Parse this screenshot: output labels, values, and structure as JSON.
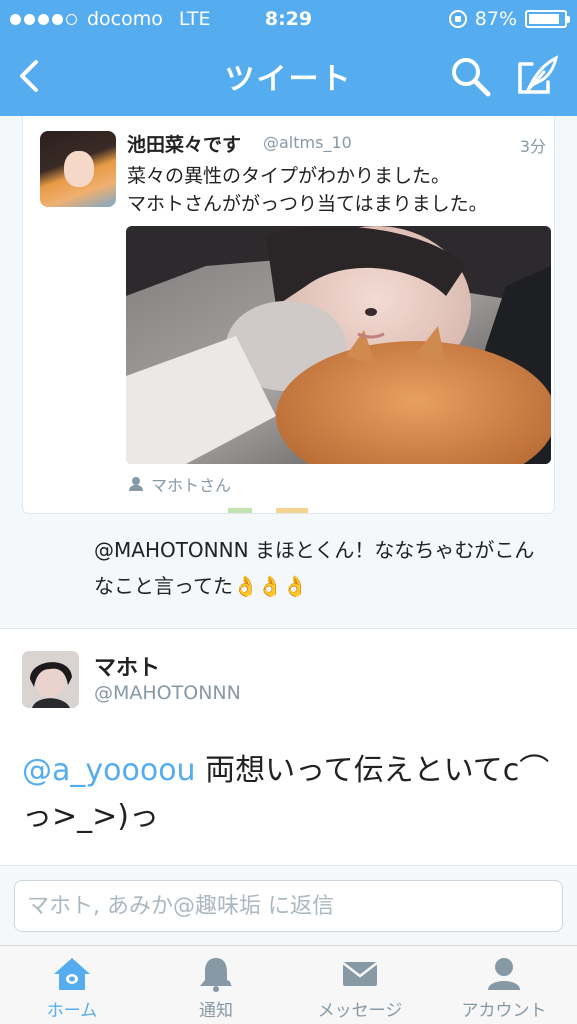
{
  "status_bar": {
    "carrier": "docomo",
    "network": "LTE",
    "time": "8:29",
    "battery_percent": "87%",
    "battery_level": 0.87,
    "signal_bars_filled": 4
  },
  "nav": {
    "title": "ツイート",
    "back_icon": "chevron-left-icon",
    "search_icon": "search-icon",
    "compose_icon": "compose-icon"
  },
  "quoted_tweet": {
    "name": "池田菜々です",
    "handle": "@altms_10",
    "time": "3分",
    "text_line1": "菜々の異性のタイプがわかりました。",
    "text_line2": "マホトさんががっつり当てはまりました。",
    "photo_caption": "マホトさん"
  },
  "reply_text": "@MAHOTONNN まほとくん！ななちゃむがこんなこと言ってた👌👌👌",
  "main_tweet": {
    "name": "マホト",
    "handle": "@MAHOTONNN",
    "mention": "@a_yoooou",
    "text": " 両想いって伝えといてc⌒っ>_>)っ"
  },
  "reply_bar": {
    "placeholder": "マホト, あみか@趣味垢 に返信"
  },
  "tabs": [
    {
      "label": "ホーム",
      "icon": "home-icon",
      "active": true
    },
    {
      "label": "通知",
      "icon": "bell-icon",
      "active": false
    },
    {
      "label": "メッセージ",
      "icon": "envelope-icon",
      "active": false
    },
    {
      "label": "アカウント",
      "icon": "person-icon",
      "active": false
    }
  ],
  "colors": {
    "brand_blue": "#55acee",
    "secondary_text": "#8899a6",
    "background": "#f5f8fa"
  }
}
